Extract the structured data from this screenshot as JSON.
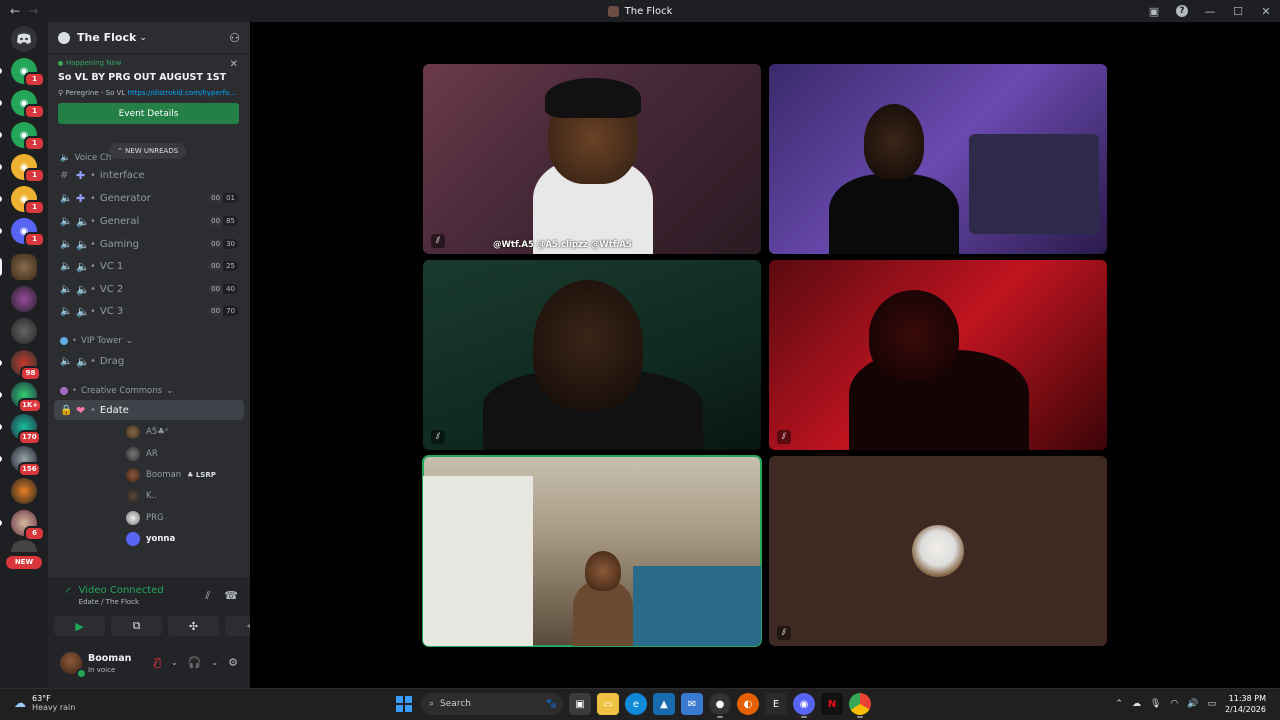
{
  "window": {
    "title": "The Flock",
    "back": "←",
    "forward": "→",
    "minimize": "—",
    "maximize": "☐",
    "close": "✕",
    "help": "?"
  },
  "rail": {
    "home_icon": "discord-logo-icon",
    "badges": [
      "1",
      "1",
      "1",
      "1",
      "1",
      "1",
      "98",
      "1K+",
      "170",
      "156",
      "6"
    ],
    "new_label": "NEW"
  },
  "guild": {
    "name": "The Flock",
    "chevron": "⌄",
    "invite_icon": "add-user-icon"
  },
  "event": {
    "status": "Happening Now",
    "title": "So VL BY PRG OUT AUGUST 1ST",
    "location_prefix": "Peregrine - So VL",
    "location_url": "https://distrokid.com/hyperfo...",
    "button": "Event Details",
    "close": "✕"
  },
  "new_unreads": "NEW UNREADS",
  "categories": {
    "voice": "Voice Ch",
    "vip": "VIP Tower",
    "creative": "Creative Commons"
  },
  "channels": [
    {
      "name": "interface",
      "type": "text"
    },
    {
      "name": "Generator",
      "type": "stage",
      "left": "00",
      "right": "01"
    },
    {
      "name": "General",
      "type": "voice",
      "left": "00",
      "right": "85"
    },
    {
      "name": "Gaming",
      "type": "voice",
      "left": "00",
      "right": "30"
    },
    {
      "name": "VC 1",
      "type": "voice",
      "left": "00",
      "right": "25"
    },
    {
      "name": "VC 2",
      "type": "voice",
      "left": "00",
      "right": "40"
    },
    {
      "name": "VC 3",
      "type": "voice",
      "left": "00",
      "right": "70"
    }
  ],
  "vip_channels": [
    {
      "name": "Drag"
    }
  ],
  "creative_channels": [
    {
      "name": "Edate"
    }
  ],
  "members": [
    {
      "name": "A5♣ᵉ",
      "icons": "🎙̸ 📹"
    },
    {
      "name": "AR",
      "icons": "📹"
    },
    {
      "name": "Booman",
      "tag": "♣ LSRP",
      "icons": "🎙̸ 📹"
    },
    {
      "name": "K..",
      "icons": "🎙̸ 📹"
    },
    {
      "name": "PRG",
      "icons": "🎙̸"
    },
    {
      "name": "yonna",
      "icons": "📹"
    }
  ],
  "voice_panel": {
    "status": "Video Connected",
    "location": "Edate / The Flock"
  },
  "user": {
    "name": "Booman",
    "state": "In voice"
  },
  "video_overlay": "@Wtf.A5  @A5.clipzz  @Wtf.A5",
  "taskbar": {
    "weather_temp": "63°F",
    "weather_desc": "Heavy rain",
    "search_placeholder": "Search",
    "time": "11:38 PM",
    "date": "2/14/2026"
  },
  "colors": {
    "green": "#23a55a",
    "blurple": "#5865f2",
    "red": "#da373c",
    "link": "#00a8fc"
  }
}
